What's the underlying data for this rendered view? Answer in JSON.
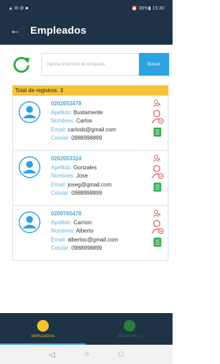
{
  "status_bar": {
    "left_icons": "▲ ✉ ⚙ ■",
    "right_text": "⏰ 36%▮ 15:30"
  },
  "header": {
    "back_icon": "←",
    "title": "Empleados"
  },
  "search": {
    "placeholder": "Ingrese el termino de busqueda",
    "button_label": "Buscar"
  },
  "total": "Total de registros: 3",
  "labels": {
    "apellido": "Apellido:",
    "nombres": "Nombres:",
    "email": "Email:",
    "celular": "Celular:"
  },
  "employees": [
    {
      "code": "0202653478",
      "apellido": "Bustamente",
      "nombres": "Carlos",
      "email": "carlosb@gmail.com",
      "celular": "0988998899"
    },
    {
      "code": "0202653324",
      "apellido": "Gonzales",
      "nombres": "Jose",
      "email": "joseg@gmail.com",
      "celular": "0988998899"
    },
    {
      "code": "0209765478",
      "apellido": "Carrion",
      "nombres": "Alberto",
      "email": "albertoc@gmail.com",
      "celular": "0988998899"
    }
  ],
  "bottom_nav": {
    "empleados": "EMPLEADOS",
    "registro": "REGISTRO 3"
  },
  "system_nav": {
    "back": "◁",
    "home": "○",
    "recents": "□"
  },
  "colors": {
    "appbar": "#1f3346",
    "accent": "#2ca3e0",
    "total_bar": "#f5c43a",
    "label": "#5cb6e4",
    "nav_active": "#f4c02f",
    "nav_inactive": "#2a7d3a",
    "icon_red": "#d9534f",
    "icon_green": "#2eaa4a"
  }
}
